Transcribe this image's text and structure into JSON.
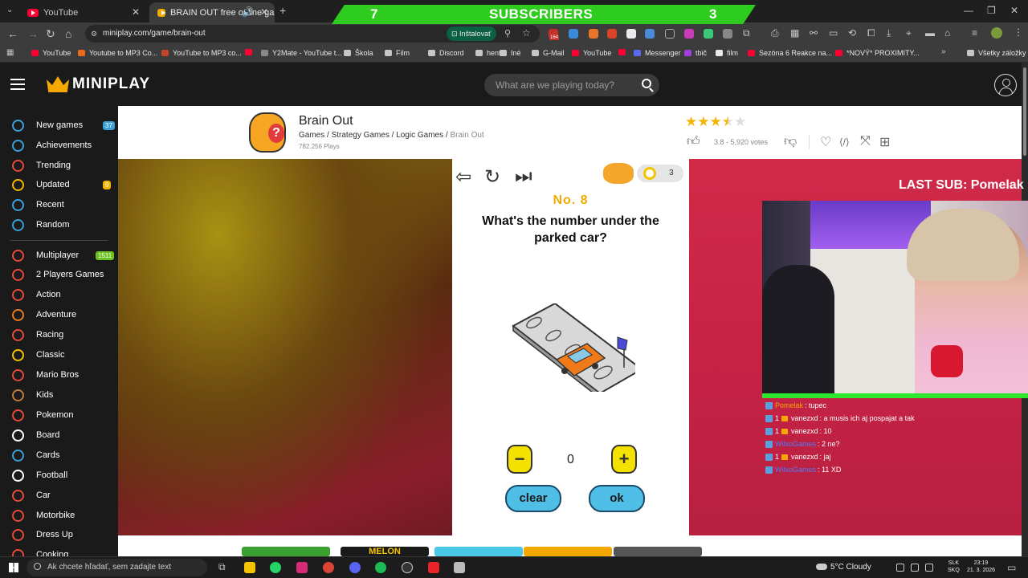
{
  "browser": {
    "tabs": [
      {
        "label": "YouTube"
      },
      {
        "label": "BRAIN OUT free online gam"
      }
    ],
    "new_tab": "+",
    "url": "miniplay.com/game/brain-out",
    "install_label": "Inštalovať",
    "extension_badge": "164",
    "bookmarks": [
      {
        "label": "YouTube",
        "color": "#ff0033"
      },
      {
        "label": "Youtube to MP3 Co...",
        "color": "#e86a1a"
      },
      {
        "label": "YouTube to MP3 co...",
        "color": "#c4432b"
      },
      {
        "label": "",
        "color": "#ff0033"
      },
      {
        "label": "Y2Mate - YouTube t...",
        "color": "#888888"
      },
      {
        "label": "Škola",
        "color": "#c4c7c5"
      },
      {
        "label": "Film",
        "color": "#c4c7c5"
      },
      {
        "label": "Discord",
        "color": "#c4c7c5"
      },
      {
        "label": "hento",
        "color": "#c4c7c5"
      },
      {
        "label": "Iné",
        "color": "#c4c7c5"
      },
      {
        "label": "G-Mail",
        "color": "#c4c7c5"
      },
      {
        "label": "YouTube",
        "color": "#ff0033"
      },
      {
        "label": "",
        "color": "#ff0033"
      },
      {
        "label": "Messenger",
        "color": "#5a6af0"
      },
      {
        "label": "tbič",
        "color": "#a040e0"
      },
      {
        "label": "film",
        "color": "#e8eaed"
      },
      {
        "label": "Sezóna 6 Reakce na...",
        "color": "#ff0033"
      },
      {
        "label": "*NOVÝ* PROXIMITY...",
        "color": "#ff0033"
      }
    ],
    "more_bookmarks": "»",
    "all_bookmarks": "Všetky záložky"
  },
  "stream": {
    "subscriber_banner": {
      "left": "7",
      "label": "SUBSCRIBERS",
      "right": "3"
    },
    "last_sub": "LAST SUB: Pomelak",
    "chat": [
      {
        "user": "Pomelak",
        "level": "",
        "text": ": tupec",
        "user_color": "#f5a800"
      },
      {
        "user": "vanezxd",
        "level": "1",
        "text": ": a musis ich aj pospajat a tak",
        "user_color": "#ffffff"
      },
      {
        "user": "vanezxd",
        "level": "1",
        "text": ": 10",
        "user_color": "#ffffff"
      },
      {
        "user": "WilxoGames",
        "level": "",
        "text": ": 2 ne?",
        "user_color": "#4a7cff"
      },
      {
        "user": "vanezxd",
        "level": "1",
        "text": ": jaj",
        "user_color": "#ffffff"
      },
      {
        "user": "WilxoGames",
        "level": "",
        "text": ": 11 XD",
        "user_color": "#4a7cff"
      }
    ]
  },
  "site": {
    "logo": "MINIPLAY",
    "search_placeholder": "What are we playing today?",
    "sidebar": [
      {
        "label": "New games",
        "badge": "37",
        "badge_color": "#3aa0d8",
        "icon_color": "#3aa0d8"
      },
      {
        "label": "Achievements",
        "badge": "",
        "badge_color": "",
        "icon_color": "#3aa0d8"
      },
      {
        "label": "Trending",
        "badge": "",
        "badge_color": "",
        "icon_color": "#e84a3a"
      },
      {
        "label": "Updated",
        "badge": "9",
        "badge_color": "#f5b400",
        "icon_color": "#f5b400"
      },
      {
        "label": "Recent",
        "badge": "",
        "badge_color": "",
        "icon_color": "#3aa0d8"
      },
      {
        "label": "Random",
        "badge": "",
        "badge_color": "",
        "icon_color": "#3aa0d8"
      },
      {
        "label": "Multiplayer",
        "badge": "1511",
        "badge_color": "#6cc020",
        "icon_color": "#e84a3a"
      },
      {
        "label": "2 Players Games",
        "badge": "",
        "badge_color": "",
        "icon_color": "#e84a3a"
      },
      {
        "label": "Action",
        "badge": "",
        "badge_color": "",
        "icon_color": "#e84a3a"
      },
      {
        "label": "Adventure",
        "badge": "",
        "badge_color": "",
        "icon_color": "#e87a1a"
      },
      {
        "label": "Racing",
        "badge": "",
        "badge_color": "",
        "icon_color": "#e84a3a"
      },
      {
        "label": "Classic",
        "badge": "",
        "badge_color": "",
        "icon_color": "#f5c400"
      },
      {
        "label": "Mario Bros",
        "badge": "",
        "badge_color": "",
        "icon_color": "#e84a3a"
      },
      {
        "label": "Kids",
        "badge": "",
        "badge_color": "",
        "icon_color": "#c07a3a"
      },
      {
        "label": "Pokemon",
        "badge": "",
        "badge_color": "",
        "icon_color": "#e84a3a"
      },
      {
        "label": "Board",
        "badge": "",
        "badge_color": "",
        "icon_color": "#ffffff"
      },
      {
        "label": "Cards",
        "badge": "",
        "badge_color": "",
        "icon_color": "#3aa0d8"
      },
      {
        "label": "Football",
        "badge": "",
        "badge_color": "",
        "icon_color": "#ffffff"
      },
      {
        "label": "Car",
        "badge": "",
        "badge_color": "",
        "icon_color": "#e84a3a"
      },
      {
        "label": "Motorbike",
        "badge": "",
        "badge_color": "",
        "icon_color": "#e84a3a"
      },
      {
        "label": "Dress Up",
        "badge": "",
        "badge_color": "",
        "icon_color": "#e84a3a"
      },
      {
        "label": "Cooking",
        "badge": "",
        "badge_color": "",
        "icon_color": "#e84a3a"
      }
    ],
    "game": {
      "title": "Brain Out",
      "breadcrumb": [
        "Games",
        "Strategy Games",
        "Logic Games"
      ],
      "breadcrumb_sep": "/",
      "breadcrumb_current": "Brain Out",
      "plays": "782.256 Plays",
      "rating": 3.5,
      "rating_max": 5,
      "votes": "3.8 - 5,920 votes"
    }
  },
  "puzzle": {
    "level": "No. 8",
    "question": "What's the number under the parked car?",
    "hints": "3",
    "answer_value": "0",
    "minus": "−",
    "plus": "+",
    "clear_label": "clear",
    "ok_label": "ok"
  },
  "thumbnails": [
    {
      "label": "",
      "color": "#3aa030"
    },
    {
      "label": "MELON",
      "color": "#1a1a1a"
    },
    {
      "label": "",
      "color": "#4ac8e8"
    },
    {
      "label": "",
      "color": "#f5a800"
    },
    {
      "label": "",
      "color": "#555555"
    }
  ],
  "taskbar": {
    "search_placeholder": "Ak chcete hľadať, sem zadajte text",
    "weather": "5°C  Cloudy",
    "lang_1": "SLK",
    "lang_2": "SKQ",
    "time": "23:19",
    "date": "21. 3. 2026"
  }
}
